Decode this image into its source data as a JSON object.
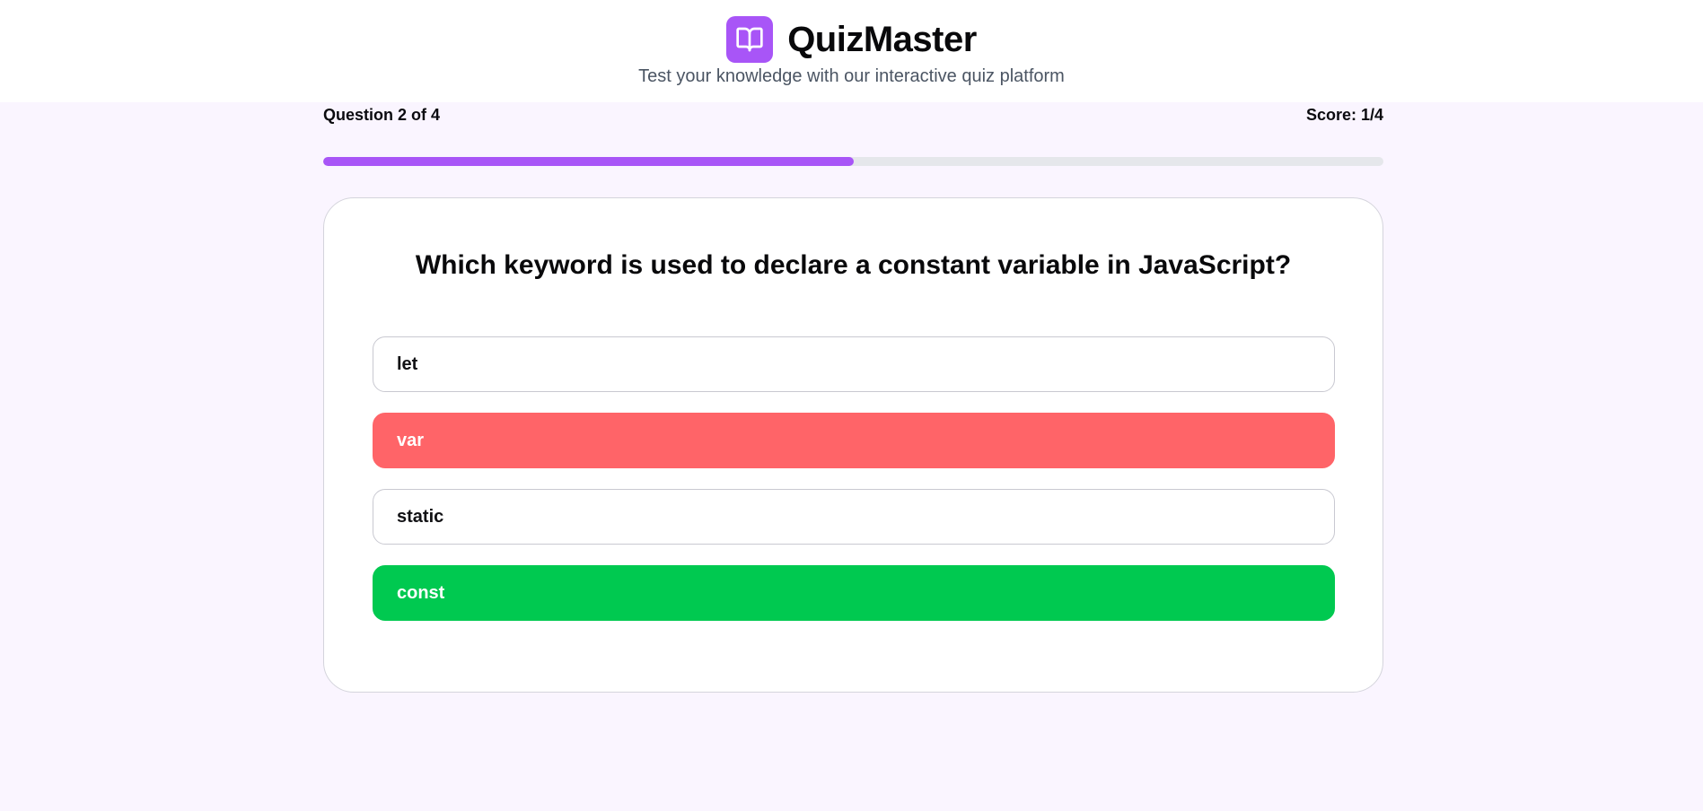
{
  "app": {
    "title": "QuizMaster",
    "tagline": "Test your knowledge with our interactive quiz platform",
    "logo_icon": "open-book-icon",
    "accent_color": "#a855f7"
  },
  "progress": {
    "question_label": "Question 2 of 4",
    "score_label": "Score: 1/4",
    "fraction": 0.5
  },
  "quiz": {
    "question": "Which keyword is used to declare a constant variable in JavaScript?",
    "options": [
      {
        "label": "let",
        "state": "neutral"
      },
      {
        "label": "var",
        "state": "wrong"
      },
      {
        "label": "static",
        "state": "neutral"
      },
      {
        "label": "const",
        "state": "correct"
      }
    ],
    "colors": {
      "wrong": "#ff6468",
      "correct": "#00c950"
    }
  }
}
